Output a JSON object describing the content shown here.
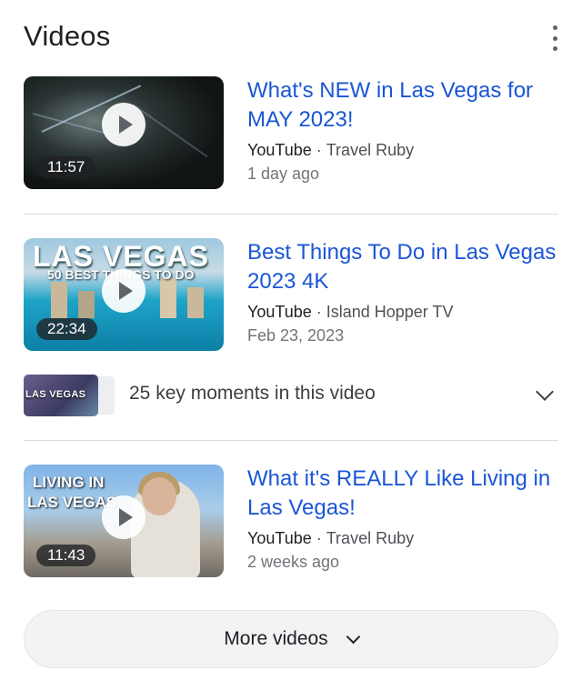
{
  "header": {
    "title": "Videos",
    "menu_icon": "more-vert-icon"
  },
  "videos": [
    {
      "title": "What's NEW in Las Vegas for MAY 2023!",
      "source": "YouTube",
      "channel": "Travel Ruby",
      "date": "1 day ago",
      "duration": "11:57"
    },
    {
      "title": "Best Things To Do in Las Vegas 2023 4K",
      "source": "YouTube",
      "channel": "Island Hopper TV",
      "date": "Feb 23, 2023",
      "duration": "22:34",
      "thumb_text": "LAS VEGAS",
      "thumb_sub": "50 BEST THINGS TO DO"
    },
    {
      "title": "What it's REALLY Like Living in Las Vegas!",
      "source": "YouTube",
      "channel": "Travel Ruby",
      "date": "2 weeks ago",
      "duration": "11:43",
      "thumb_line1": "LIVING IN",
      "thumb_line2": "LAS VEGAS"
    }
  ],
  "key_moments": {
    "label": "25 key moments in this video",
    "thumb_text": "LAS VEGAS"
  },
  "more_button": {
    "label": "More videos"
  },
  "colors": {
    "link": "#1a56d6",
    "meta": "#4d5156",
    "divider": "#dadce0"
  },
  "separator": "·"
}
